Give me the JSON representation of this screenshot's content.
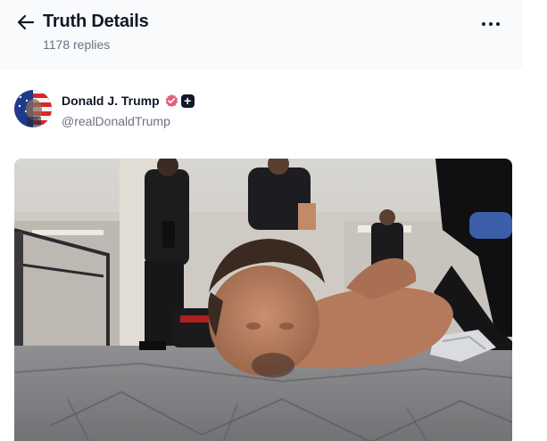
{
  "header": {
    "back_icon": "arrow-left-icon",
    "title": "Truth Details",
    "replies": "1178 replies",
    "more_icon": "more-horizontal-icon"
  },
  "post": {
    "author": {
      "display_name": "Donald J. Trump",
      "handle": "@realDonaldTrump",
      "verified_badge_icon": "verified-check-icon",
      "plus_badge_icon": "plus-icon",
      "verified_color": "#e25f7a"
    },
    "media": {
      "kind": "photo"
    }
  },
  "colors": {
    "title": "#111827",
    "secondary_text": "#6b7280",
    "header_bg": "#f9fafb"
  }
}
